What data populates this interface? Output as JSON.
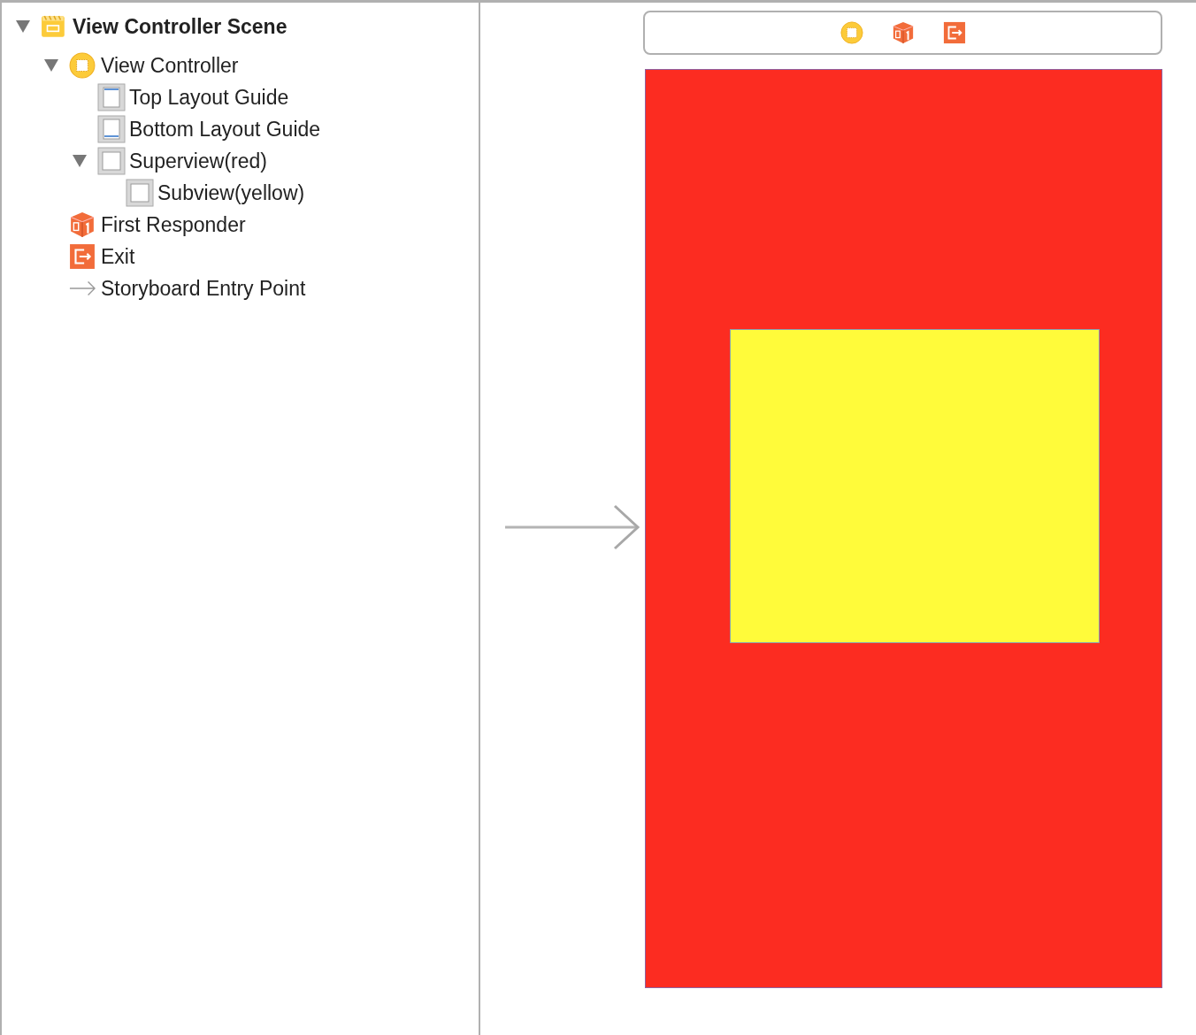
{
  "outline": [
    {
      "kind": "scene",
      "label": "View Controller Scene",
      "expanded": true,
      "children": [
        {
          "kind": "controller",
          "label": "View Controller",
          "expanded": true,
          "children": [
            {
              "kind": "top-guide",
              "label": "Top Layout Guide"
            },
            {
              "kind": "bottom-guide",
              "label": "Bottom Layout Guide"
            },
            {
              "kind": "view",
              "label": "Superview(red)",
              "expanded": true,
              "children": [
                {
                  "kind": "view",
                  "label": "Subview(yellow)"
                }
              ]
            }
          ]
        },
        {
          "kind": "responder",
          "label": "First Responder"
        },
        {
          "kind": "exit",
          "label": "Exit"
        },
        {
          "kind": "entry",
          "label": "Storyboard Entry Point"
        }
      ]
    }
  ],
  "scene_dock": [
    {
      "kind": "controller"
    },
    {
      "kind": "responder"
    },
    {
      "kind": "exit"
    }
  ],
  "canvas": {
    "entry_arrow": true
  }
}
